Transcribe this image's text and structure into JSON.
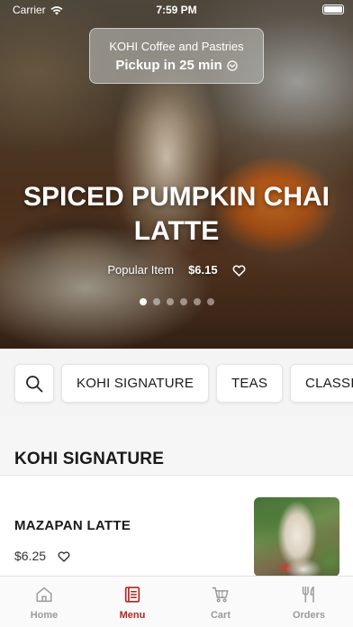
{
  "status_bar": {
    "carrier": "Carrier",
    "time": "7:59 PM",
    "battery_level": 1.0
  },
  "pickup": {
    "store_name": "KOHI Coffee and Pastries",
    "pickup_label": "Pickup in 25 min"
  },
  "hero": {
    "title": "SPICED PUMPKIN CHAI LATTE",
    "tag": "Popular Item",
    "price": "$6.15",
    "slide_count": 6,
    "active_slide": 1
  },
  "categories": [
    "KOHI SIGNATURE",
    "TEAS",
    "CLASSICS"
  ],
  "section": {
    "title": "KOHI SIGNATURE"
  },
  "items": [
    {
      "name": "MAZAPAN LATTE",
      "price": "$6.25"
    }
  ],
  "tabs": [
    {
      "label": "Home",
      "icon": "home-icon",
      "active": false
    },
    {
      "label": "Menu",
      "icon": "menu-book-icon",
      "active": true
    },
    {
      "label": "Cart",
      "icon": "cart-icon",
      "active": false
    },
    {
      "label": "Orders",
      "icon": "utensils-icon",
      "active": false
    }
  ],
  "colors": {
    "accent": "#b3261e",
    "inactive_tab": "#9a9a9a"
  }
}
